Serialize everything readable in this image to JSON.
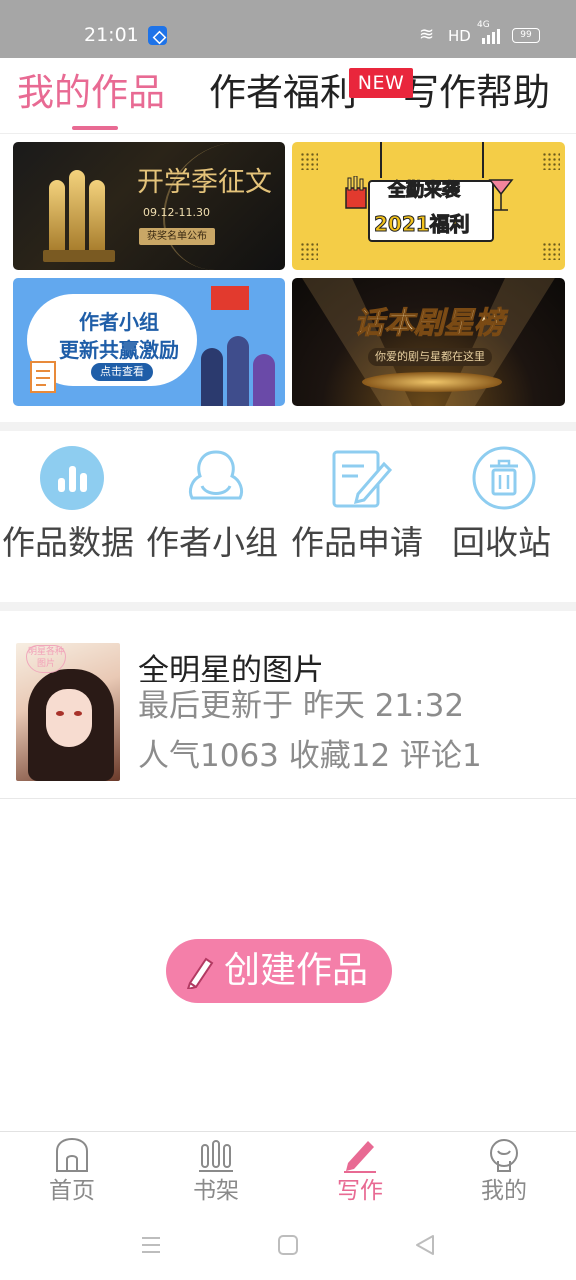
{
  "status_bar": {
    "time": "21:01",
    "wifi_icon": "wifi-icon",
    "network": "HD",
    "cell_type": "4G",
    "battery": "99"
  },
  "top_tabs": [
    {
      "label": "我的作品",
      "active": true
    },
    {
      "label": "作者福利",
      "active": false
    },
    {
      "label": "写作帮助",
      "active": false
    }
  ],
  "new_badge": "NEW",
  "banners": [
    {
      "title": "开学季征文",
      "date": "09.12-11.30",
      "button": "获奖名单公布"
    },
    {
      "line1": "全勤来袭",
      "line2": "2021福利"
    },
    {
      "line1": "作者小组",
      "line2": "更新共赢激励",
      "button": "点击查看"
    },
    {
      "title": "话本剧星榜",
      "subtitle": "你爱的剧与星都在这里"
    }
  ],
  "quick_actions": [
    {
      "label": "作品数据",
      "icon": "bar-chart-icon"
    },
    {
      "label": "作者小组",
      "icon": "group-icon"
    },
    {
      "label": "作品申请",
      "icon": "edit-document-icon"
    },
    {
      "label": "回收站",
      "icon": "trash-icon"
    }
  ],
  "work": {
    "title": "全明星的图片",
    "updated": "最后更新于 昨天 21:32",
    "stats": "人气1063 收藏12 评论1",
    "cover_text": "明星各种图片"
  },
  "create_button": "创建作品",
  "bottom_nav": [
    {
      "label": "首页",
      "icon": "home-icon",
      "active": false
    },
    {
      "label": "书架",
      "icon": "bookshelf-icon",
      "active": false
    },
    {
      "label": "写作",
      "icon": "pencil-icon",
      "active": true
    },
    {
      "label": "我的",
      "icon": "profile-icon",
      "active": false
    }
  ],
  "colors": {
    "accent": "#e86a93",
    "create_button": "#f47fa9",
    "icon_blue": "#8ecdf0",
    "badge_red": "#e9263c"
  }
}
